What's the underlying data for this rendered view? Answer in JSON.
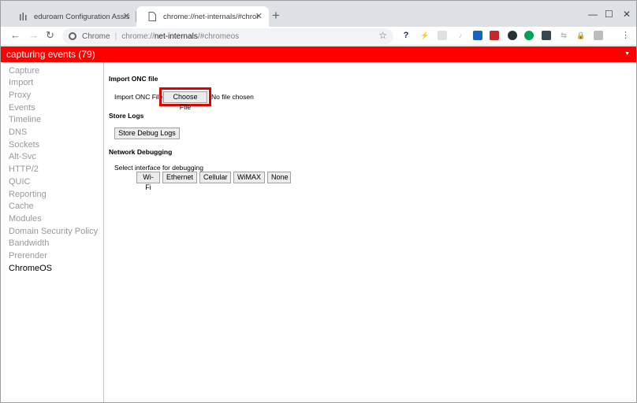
{
  "browser": {
    "tabs": [
      {
        "title": "eduroam Configuration Assistant",
        "active": false
      },
      {
        "title": "chrome://net-internals/#chromeos",
        "active": true
      }
    ],
    "new_tab": "+",
    "close_glyph": "✕",
    "window_controls": {
      "minimize": "—",
      "maximize": "☐",
      "close": "✕"
    },
    "omnibox": {
      "scheme_label": "Chrome",
      "url_prefix": "chrome://",
      "url_host": "net-internals",
      "url_path": "/#chromeos"
    },
    "icons": [
      "back-icon",
      "forward-icon",
      "reload-icon",
      "star-icon",
      "menu-icon"
    ]
  },
  "status": {
    "text": "capturing events (79)",
    "color": "#ff0000",
    "arrow": "▼"
  },
  "sidebar": {
    "items": [
      {
        "label": "Capture"
      },
      {
        "label": "Import"
      },
      {
        "label": "Proxy"
      },
      {
        "label": "Events"
      },
      {
        "label": "Timeline"
      },
      {
        "label": "DNS"
      },
      {
        "label": "Sockets"
      },
      {
        "label": "Alt-Svc"
      },
      {
        "label": "HTTP/2"
      },
      {
        "label": "QUIC"
      },
      {
        "label": "Reporting"
      },
      {
        "label": "Cache"
      },
      {
        "label": "Modules"
      },
      {
        "label": "Domain Security Policy"
      },
      {
        "label": "Bandwidth"
      },
      {
        "label": "Prerender"
      },
      {
        "label": "ChromeOS",
        "selected": true
      }
    ]
  },
  "main": {
    "import_onc": {
      "title": "Import ONC file",
      "label": "Import ONC File",
      "button": "Choose File",
      "file_status": "No file chosen"
    },
    "store_logs": {
      "title": "Store Logs",
      "button": "Store Debug Logs"
    },
    "network_debugging": {
      "title": "Network Debugging",
      "label": "Select interface for debugging",
      "buttons": [
        "Wi-Fi",
        "Ethernet",
        "Cellular",
        "WiMAX",
        "None"
      ]
    }
  }
}
